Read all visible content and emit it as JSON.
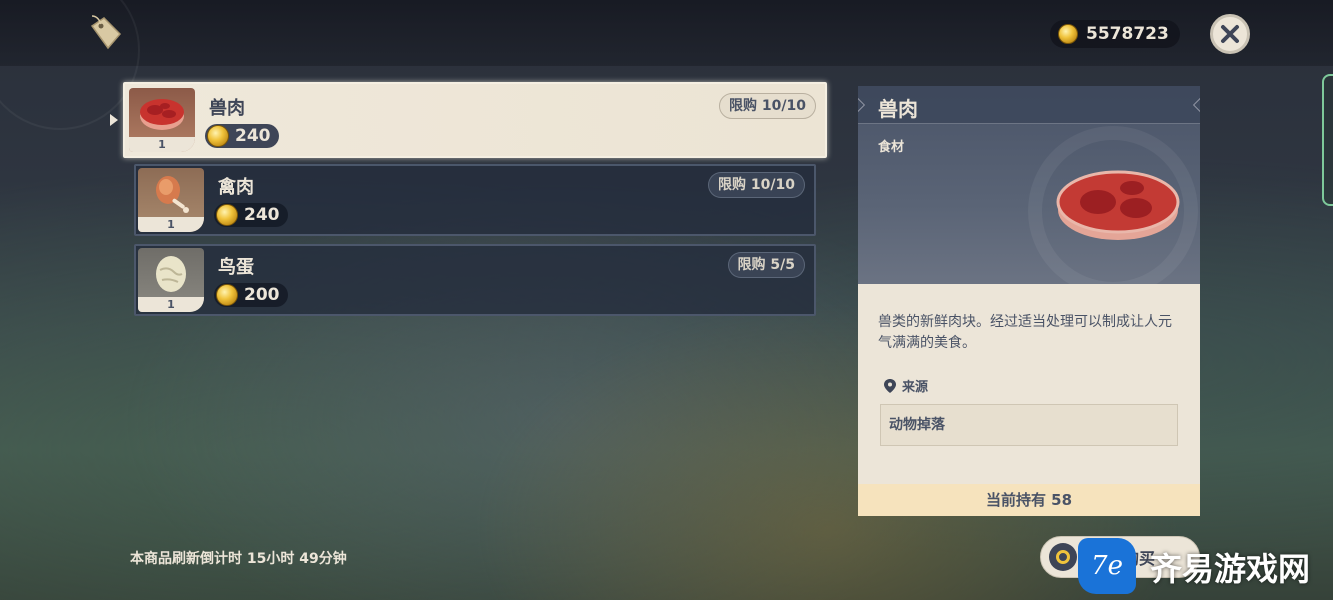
{
  "header": {
    "currency_amount": "5578723",
    "icons": [
      "shop-tag-icon",
      "coin-icon",
      "close-icon"
    ]
  },
  "items": [
    {
      "name": "兽肉",
      "count": "1",
      "price": "240",
      "limit": "限购 10/10",
      "icon": "raw-meat-icon",
      "selected": true
    },
    {
      "name": "禽肉",
      "count": "1",
      "price": "240",
      "limit": "限购 10/10",
      "icon": "fowl-icon",
      "selected": false
    },
    {
      "name": "鸟蛋",
      "count": "1",
      "price": "200",
      "limit": "限购 5/5",
      "icon": "bird-egg-icon",
      "selected": false
    }
  ],
  "detail": {
    "title": "兽肉",
    "category": "食材",
    "description": "兽类的新鲜肉块。经过适当处理可以制成让人元气满满的美食。",
    "source_label": "来源",
    "source_value": "动物掉落",
    "holding": "当前持有 58"
  },
  "footer": {
    "refresh_text": "本商品刷新倒计时 15小时 49分钟",
    "buy_label": "购买"
  },
  "watermark": {
    "badge": "7e",
    "text": "齐易游戏网"
  },
  "colors": {
    "panel_light": "#ece5d8",
    "panel_dark": "#3e4557",
    "coin_gold": "#f0c33c",
    "hold_bar": "#f6e3bd",
    "watermark_blue": "#1a73d8"
  }
}
